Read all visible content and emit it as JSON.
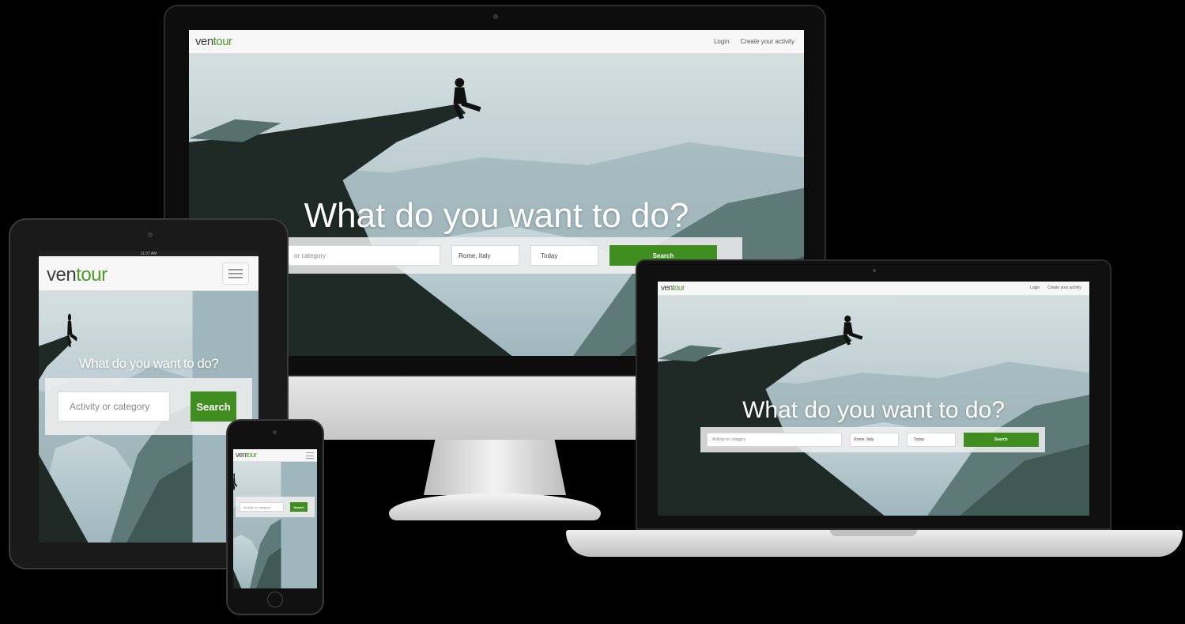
{
  "brand": {
    "logo_prefix": "ven",
    "logo_suffix": "tour",
    "accent_color": "#3f8e1f"
  },
  "nav": {
    "login": "Login",
    "create": "Create your activity",
    "menu_icon": "hamburger-icon"
  },
  "hero": {
    "headline": "What do you want to do?",
    "tablet_headline": "What do you want to do?"
  },
  "search": {
    "activity_placeholder": "Activity or category",
    "activity_partial": "or category",
    "location_value": "Rome, Italy",
    "date_value": "Today",
    "button_label": "Search"
  },
  "tablet_status": {
    "time": "11:07 AM"
  }
}
